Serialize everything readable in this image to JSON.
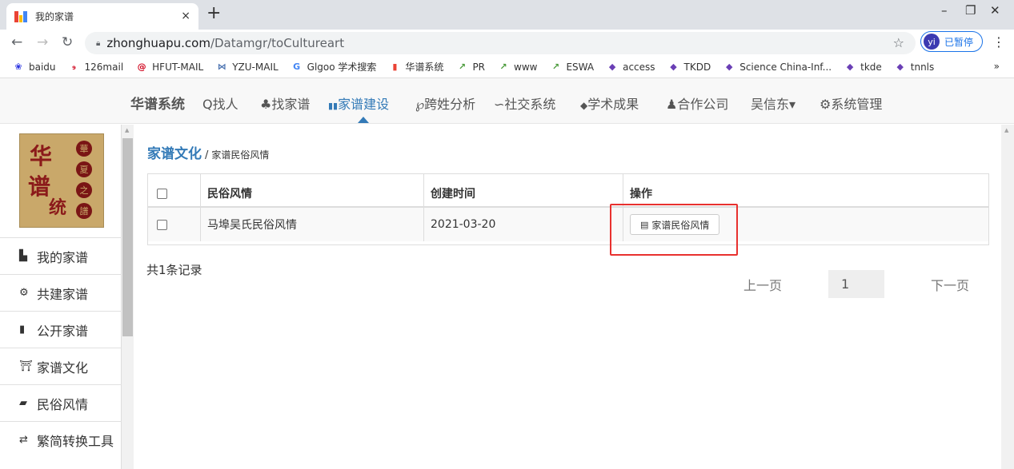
{
  "browser": {
    "tab_title": "我的家谱",
    "tab_close": "×",
    "new_tab": "+",
    "url_host": "zhonghuapu.com",
    "url_path": "/Datamgr/toCultureart",
    "profile_initials": "yi",
    "profile_status": "已暂停",
    "window_controls": [
      "–",
      "❐",
      "✕"
    ]
  },
  "bookmarks": [
    {
      "label": "baidu",
      "icon": "paw-icon",
      "color": "#2932e1"
    },
    {
      "label": "126mail",
      "icon": "mail-126-icon",
      "color": "#d0021b"
    },
    {
      "label": "HFUT-MAIL",
      "icon": "hfut-mail-icon",
      "color": "#d0021b"
    },
    {
      "label": "YZU-MAIL",
      "icon": "yzu-mail-icon",
      "color": "#4a72b0"
    },
    {
      "label": "Glgoo 学术搜索",
      "icon": "glgoo-icon",
      "color": "#4285f4"
    },
    {
      "label": "华谱系统",
      "icon": "huapu-icon",
      "color": "#ea4335"
    },
    {
      "label": "PR",
      "icon": "arrow-a-icon",
      "color": "#4a9a3a"
    },
    {
      "label": "www",
      "icon": "arrow-a-icon",
      "color": "#4a9a3a"
    },
    {
      "label": "ESWA",
      "icon": "arrow-a-icon",
      "color": "#4a9a3a"
    },
    {
      "label": "access",
      "icon": "hex-icon",
      "color": "#6a3fb5"
    },
    {
      "label": "TKDD",
      "icon": "hex-icon",
      "color": "#6a3fb5"
    },
    {
      "label": "Science China-Inf...",
      "icon": "hex-icon",
      "color": "#6a3fb5"
    },
    {
      "label": "tkde",
      "icon": "hex-icon",
      "color": "#6a3fb5"
    },
    {
      "label": "tnnls",
      "icon": "hex-icon",
      "color": "#6a3fb5"
    }
  ],
  "bookmarks_more": "»",
  "sitenav": {
    "brand": "华谱系统",
    "items": [
      {
        "label": "找人",
        "icon": "search-icon",
        "glyph": "Q"
      },
      {
        "label": "找家谱",
        "icon": "tree-icon",
        "glyph": "♣"
      },
      {
        "label": "家谱建设",
        "icon": "book-icon",
        "glyph": "▮▮",
        "active": true
      },
      {
        "label": "跨姓分析",
        "icon": "analysis-icon",
        "glyph": "℘"
      },
      {
        "label": "社交系统",
        "icon": "link-icon",
        "glyph": "∽"
      },
      {
        "label": "学术成果",
        "icon": "graduation-icon",
        "glyph": "◆"
      },
      {
        "label": "合作公司",
        "icon": "users-icon",
        "glyph": "♟"
      },
      {
        "label": "吴信东",
        "icon": "caret-down-icon",
        "glyph": "▾"
      },
      {
        "label": "系统管理",
        "icon": "gears-icon",
        "glyph": "⚙"
      }
    ]
  },
  "sidebar": {
    "logo": {
      "big": [
        "华",
        "谱",
        "统"
      ],
      "seals": [
        "華",
        "夏",
        "之",
        "譜"
      ]
    },
    "items": [
      {
        "label": "我的家谱",
        "icon": "file-icon",
        "glyph": "▙"
      },
      {
        "label": "共建家谱",
        "icon": "gears-icon",
        "glyph": "⚙"
      },
      {
        "label": "公开家谱",
        "icon": "book-icon",
        "glyph": "▮"
      },
      {
        "label": "家谱文化",
        "icon": "institution-icon",
        "glyph": "⛩"
      },
      {
        "label": "民俗风情",
        "icon": "book-solid-icon",
        "glyph": "▰"
      },
      {
        "label": "繁简转换工具",
        "icon": "exchange-icon",
        "glyph": "⇄"
      }
    ]
  },
  "breadcrumb": {
    "section": "家谱文化",
    "separator": "/",
    "page": "家谱民俗风情"
  },
  "table": {
    "headers": [
      "民俗风情",
      "创建时间",
      "操作"
    ],
    "rows": [
      {
        "name": "马埠吴氏民俗风情",
        "date": "2021-03-20",
        "action": "家谱民俗风情"
      }
    ]
  },
  "record_count": "共1条记录",
  "pagination": {
    "prev": "上一页",
    "current": "1",
    "next": "下一页"
  }
}
